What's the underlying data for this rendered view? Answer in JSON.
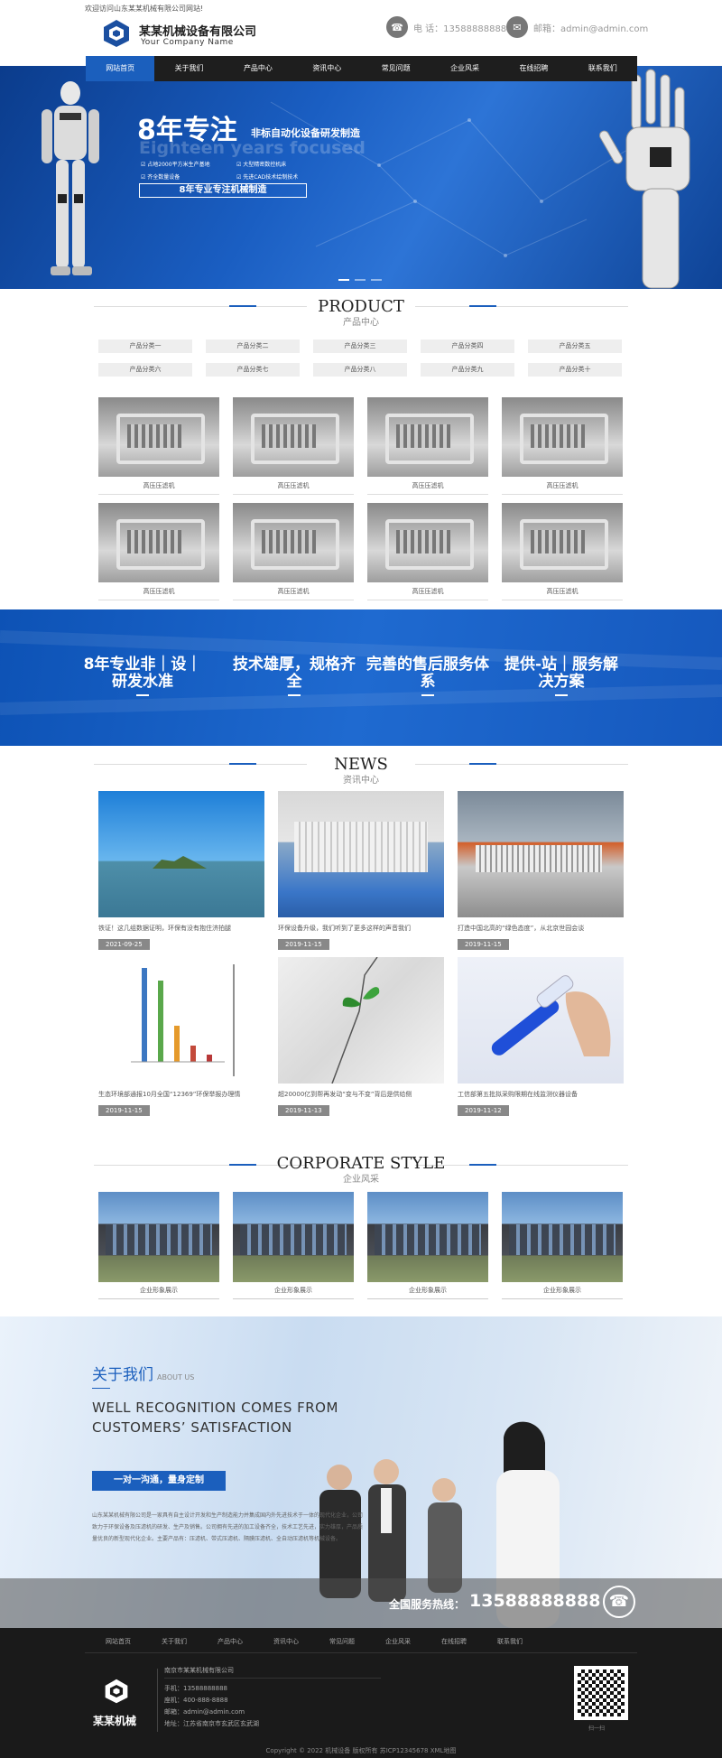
{
  "header": {
    "welcome": "欢迎访问山东某某机械有限公司网站!",
    "company": "某某机械设备有限公司",
    "company_en": "Your Company Name",
    "phone": "电 话：13588888888",
    "email": "邮箱：admin@admin.com"
  },
  "nav": [
    "网站首页",
    "关于我们",
    "产品中心",
    "资讯中心",
    "常见问题",
    "企业风采",
    "在线招聘",
    "联系我们"
  ],
  "banner": {
    "title": "8年专注",
    "subtitle": "非标自动化设备研发制造",
    "ghost": "Eighteen years focused",
    "features": [
      "占地2000平方米生产基地",
      "大型精密数控机床",
      "齐全数量设备",
      "先进CAD技术绘制技术"
    ],
    "box": "8年专业专注机械制造"
  },
  "product": {
    "title_en": "PRODUCT",
    "title_cn": "产品中心",
    "categories": [
      "产品分类一",
      "产品分类二",
      "产品分类三",
      "产品分类四",
      "产品分类五",
      "产品分类六",
      "产品分类七",
      "产品分类八",
      "产品分类九",
      "产品分类十"
    ],
    "items": [
      "高压压滤机",
      "高压压滤机",
      "高压压滤机",
      "高压压滤机",
      "高压压滤机",
      "高压压滤机",
      "高压压滤机",
      "高压压滤机"
    ]
  },
  "advantages": [
    "8年专业非｜设｜研发水准",
    "技术雄厚，规格齐全",
    "完善的售后服务体系",
    "提供-站｜服务解决方案"
  ],
  "news": {
    "title_en": "NEWS",
    "title_cn": "资讯中心",
    "items": [
      {
        "text": "铁证！这几组数据证明，环保有没有抱住济拍腿",
        "date": "2021-09-25"
      },
      {
        "text": "环保设备升级，我们听到了更多这样的声音我们",
        "date": "2019-11-15"
      },
      {
        "text": "打造中国北高的“绿色态度”，从北京世园会谈",
        "date": "2019-11-15"
      },
      {
        "text": "生态环境部通报10月全国“12369”环保举报办理情",
        "date": "2019-11-15"
      },
      {
        "text": "超20000亿到帮再发动“变与不变”背后是供给侧",
        "date": "2019-11-13"
      },
      {
        "text": "工信部第五批拟采购限期在线监测仪器设备",
        "date": "2019-11-12"
      }
    ]
  },
  "corporate": {
    "title_en": "CORPORATE STYLE",
    "title_cn": "企业风采",
    "items": [
      "企业形象展示",
      "企业形象展示",
      "企业形象展示",
      "企业形象展示"
    ]
  },
  "about": {
    "title": "关于我们",
    "title_en": "ABOUT US",
    "line1": "WELL RECOGNITION COMES FROM",
    "line2": "CUSTOMERS’   SATISFACTION",
    "button": "一对一沟通，量身定制",
    "text": "山东某某机械有限公司是一家具有自主设计开发和生产制造能力并集成国内外先进技术于一体的现代化企业，公司致力于环保设备及压滤机的研发、生产及销售。公司拥有先进的加工设备齐全，技术工艺先进，实力雄厚，产品质量优良的新型现代化企业。主要产品有：压滤机、带式压滤机、隔膜压滤机、全自动压滤机等机械设备。",
    "hotline_label": "全国服务热线：",
    "hotline": "13588888888"
  },
  "footer": {
    "nav": [
      "网站首页",
      "关于我们",
      "产品中心",
      "资讯中心",
      "常见问题",
      "企业风采",
      "在线招聘",
      "联系我们"
    ],
    "brand": "某某机械",
    "company": "南京市某某机械有限公司",
    "phone": "手机：13588888888",
    "tel": "座机：400-888-8888",
    "email": "邮箱：admin@admin.com",
    "address": "地址：江苏省南京市玄武区玄武湖",
    "qr_caption": "扫一扫",
    "copyright": "Copyright © 2022 机械设备 版权所有 苏ICP12345678 XML地图"
  },
  "colors": {
    "brand": "#1b5fbd",
    "nav_bg": "#1e1e1e",
    "footer_bg": "#1a1a1a"
  }
}
